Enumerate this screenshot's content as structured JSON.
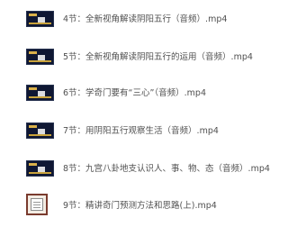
{
  "files": [
    {
      "name": "4节：全新视角解读阴阳五行（音频）.mp4",
      "thumbnail": "video-thumbnail-dark"
    },
    {
      "name": "5节：全新视角解读阴阳五行的运用（音频）.mp4",
      "thumbnail": "video-thumbnail-dark"
    },
    {
      "name": "6节：学奇门要有“三心”（音频）.mp4",
      "thumbnail": "video-thumbnail-dark"
    },
    {
      "name": "7节：用阴阳五行观察生活（音频）.mp4",
      "thumbnail": "video-thumbnail-dark"
    },
    {
      "name": "8节：九宫八卦地支认识人、事、物、态（音频）.mp4",
      "thumbnail": "video-thumbnail-dark"
    },
    {
      "name": "9节：精讲奇门预测方法和思路(上).mp4",
      "thumbnail": "video-thumbnail-document"
    }
  ]
}
